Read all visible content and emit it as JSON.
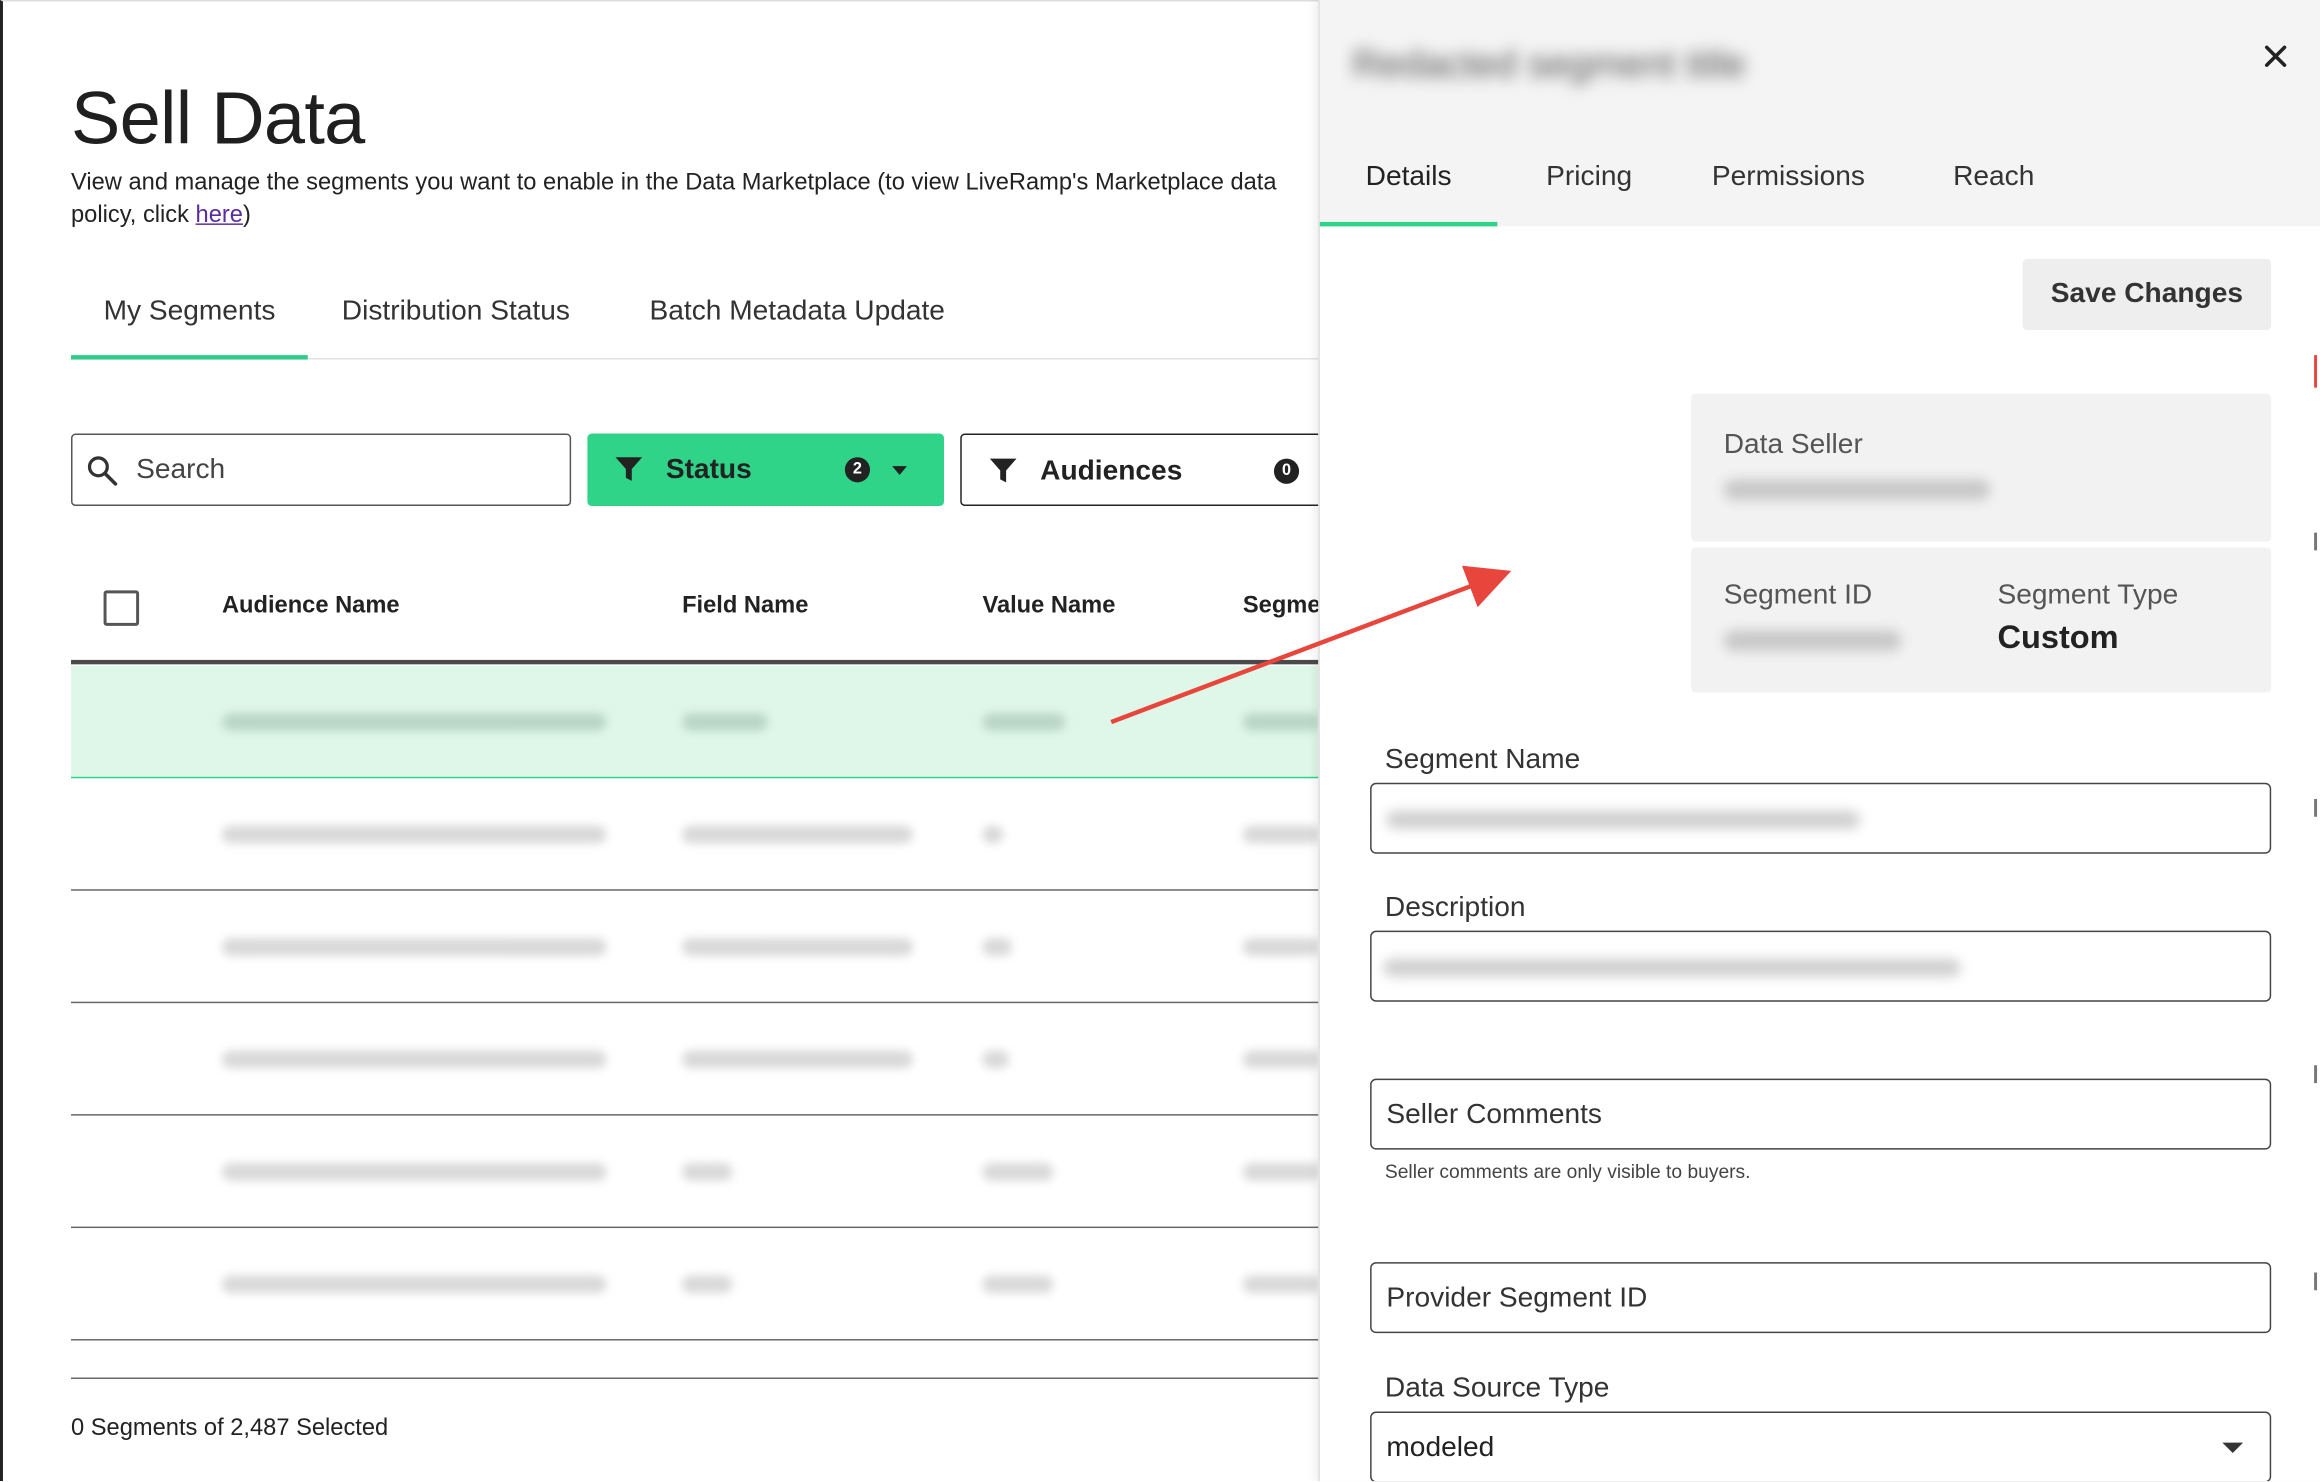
{
  "page": {
    "title": "Sell Data",
    "description_prefix": "View and manage the segments you want to enable in the Data Marketplace (to view LiveRamp's Marketplace data",
    "description_suffix_1": "policy, click ",
    "description_link": "here",
    "description_suffix_2": ")"
  },
  "tabs": [
    "My Segments",
    "Distribution Status",
    "Batch Metadata Update"
  ],
  "search": {
    "placeholder": "Search"
  },
  "filters": {
    "status": {
      "label": "Status",
      "count": "2"
    },
    "audiences": {
      "label": "Audiences",
      "count": "0"
    }
  },
  "table": {
    "columns": [
      "Audience Name",
      "Field Name",
      "Value Name",
      "Segme"
    ],
    "selected_row_index": 0,
    "row_count_visible": 6
  },
  "footer": {
    "selection_text": "0 Segments of 2,487 Selected"
  },
  "drawer": {
    "title": "Redacted segment title",
    "tabs": [
      "Details",
      "Pricing",
      "Permissions",
      "Reach"
    ],
    "active_tab": "Details",
    "save_label": "Save Changes",
    "data_seller_label": "Data Seller",
    "segment_id_label": "Segment ID",
    "segment_type_label": "Segment Type",
    "segment_type_value": "Custom",
    "segment_name_label": "Segment Name",
    "description_label": "Description",
    "seller_comments_placeholder": "Seller Comments",
    "seller_comments_help": "Seller comments are only visible to buyers.",
    "provider_segment_id_placeholder": "Provider Segment ID",
    "data_source_type_label": "Data Source Type",
    "data_source_type_value": "modeled"
  },
  "colors": {
    "accent": "#30d488",
    "selected_row": "#dff7e9",
    "annotation_arrow": "#e8453c",
    "link": "#5a2ca0"
  }
}
